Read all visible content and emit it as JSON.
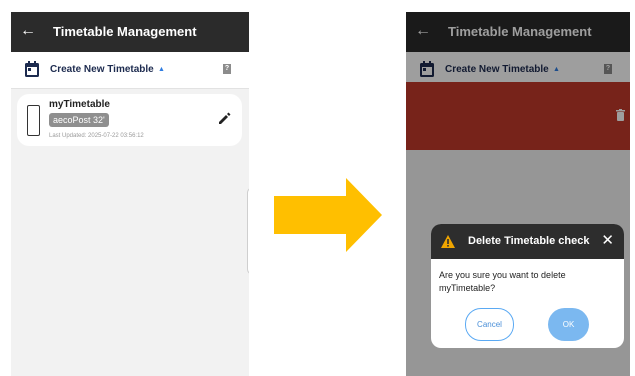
{
  "left_screen": {
    "app_title": "Timetable Management",
    "toolbar": {
      "create_label": "Create New Timetable"
    },
    "card": {
      "name": "myTimetable",
      "chip": "aecoPost 32'",
      "updated": "Last Updated: 2025-07-22 03:56:12"
    }
  },
  "right_screen": {
    "app_title": "Timetable Management",
    "toolbar": {
      "create_label": "Create New Timetable"
    },
    "dialog": {
      "title": "Delete Timetable check",
      "message": "Are you sure you want to delete myTimetable?",
      "cancel_label": "Cancel",
      "ok_label": "OK"
    }
  },
  "colors": {
    "appbar": "#2b2b2b",
    "accent": "#2f7de1",
    "arrow": "#ffbf00",
    "delete_band": "#c0392b",
    "ok_button": "#7bb8f0"
  },
  "icons": [
    "back-arrow-icon",
    "calendar-icon",
    "caret-up-icon",
    "help-icon",
    "phone-icon",
    "edit-pencil-icon",
    "trash-icon",
    "warning-icon",
    "close-icon"
  ]
}
